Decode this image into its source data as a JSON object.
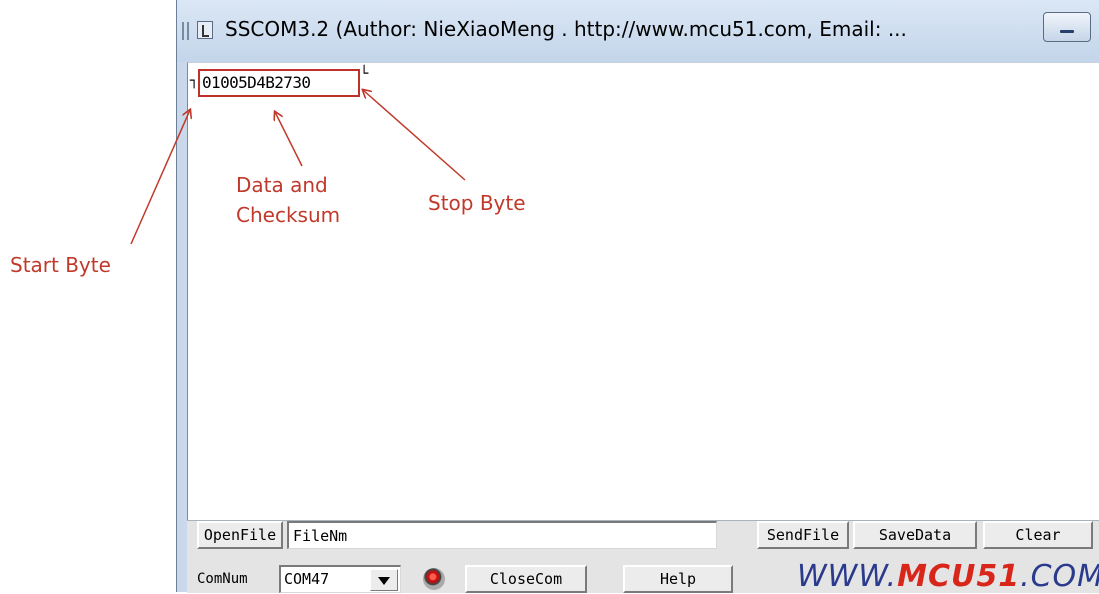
{
  "window": {
    "title": "SSCOM3.2 (Author: NieXiaoMeng .  http://www.mcu51.com,  Email: ..."
  },
  "receive_area": {
    "text": "01005D4B2730",
    "start_glyph": "┐",
    "stop_glyph": "└"
  },
  "annotations": {
    "start_byte": "Start Byte",
    "data_checksum_line1": "Data and",
    "data_checksum_line2": "Checksum",
    "stop_byte": "Stop Byte",
    "color": "#c0392b"
  },
  "bottom_panel": {
    "open_file_label": "OpenFile",
    "file_name_value": "FileNm",
    "send_file_label": "SendFile",
    "save_data_label": "SaveData",
    "clear_label": "Clear",
    "com_num_label": "ComNum",
    "com_port_value": "COM47",
    "close_com_label": "CloseCom",
    "help_label": "Help",
    "logo_prefix": "WWW.",
    "logo_brand": "MCU51",
    "logo_suffix": ".COM"
  }
}
